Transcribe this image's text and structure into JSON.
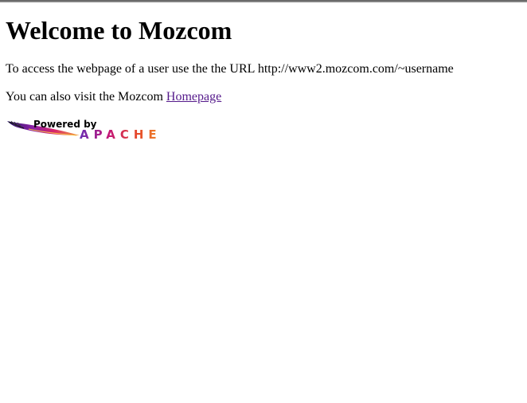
{
  "heading": "Welcome to Mozcom",
  "intro_text": "To access the webpage of a user use the the URL http://www2.mozcom.com/~username",
  "visit_text": "You can also visit the Mozcom ",
  "homepage_link": "Homepage",
  "logo": {
    "powered_by": "Powered by",
    "brand": "APACHE"
  },
  "colors": {
    "link_visited": "#551a8b",
    "logo_text_gradient": [
      "#6b2fb3",
      "#c2177a",
      "#e5482b",
      "#f08a2a"
    ]
  },
  "icons": [
    "apache-feather-icon"
  ]
}
